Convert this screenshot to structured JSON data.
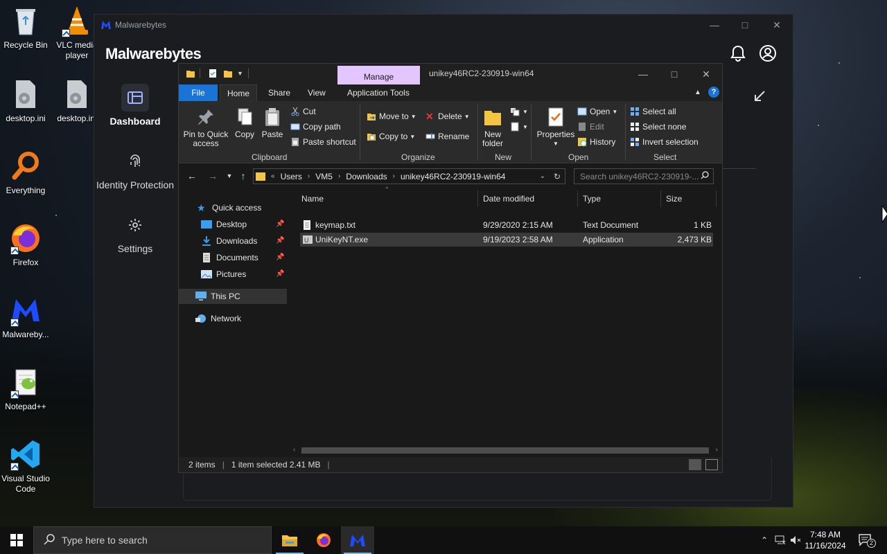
{
  "desktop": {
    "icons": [
      {
        "label": "Recycle Bin"
      },
      {
        "label": "VLC media player"
      },
      {
        "label": "desktop.ini"
      },
      {
        "label": "desktop.ini"
      },
      {
        "label": "Everything"
      },
      {
        "label": "Firefox"
      },
      {
        "label": "Malwareby..."
      },
      {
        "label": "Notepad++"
      },
      {
        "label": "Visual Studio Code"
      }
    ]
  },
  "malwarebytes": {
    "window_title": "Malwarebytes",
    "brand": "Malwarebytes",
    "nav": [
      {
        "label": "Dashboard",
        "icon": "dashboard-icon"
      },
      {
        "label": "Identity Protection",
        "icon": "fingerprint-icon"
      },
      {
        "label": "Settings",
        "icon": "gear-icon"
      }
    ]
  },
  "explorer": {
    "manage_tab": "Manage",
    "title": "unikey46RC2-230919-win64",
    "tabs": [
      "File",
      "Home",
      "Share",
      "View",
      "Application Tools"
    ],
    "ribbon": {
      "clipboard": {
        "group": "Clipboard",
        "pin": "Pin to Quick access",
        "copy": "Copy",
        "paste": "Paste",
        "cut": "Cut",
        "copy_path": "Copy path",
        "paste_shortcut": "Paste shortcut"
      },
      "organize": {
        "group": "Organize",
        "move_to": "Move to",
        "copy_to": "Copy to",
        "delete": "Delete",
        "rename": "Rename"
      },
      "new": {
        "group": "New",
        "new_folder": "New folder"
      },
      "open": {
        "group": "Open",
        "properties": "Properties",
        "open": "Open",
        "edit": "Edit",
        "history": "History"
      },
      "select": {
        "group": "Select",
        "select_all": "Select all",
        "select_none": "Select none",
        "invert": "Invert selection"
      }
    },
    "address": {
      "crumbs": [
        "Users",
        "VM5",
        "Downloads",
        "unikey46RC2-230919-win64"
      ],
      "search_placeholder": "Search unikey46RC2-230919-..."
    },
    "nav": {
      "quick_access": "Quick access",
      "items": [
        {
          "label": "Desktop"
        },
        {
          "label": "Downloads"
        },
        {
          "label": "Documents"
        },
        {
          "label": "Pictures"
        }
      ],
      "this_pc": "This PC",
      "network": "Network"
    },
    "columns": {
      "name": "Name",
      "date": "Date modified",
      "type": "Type",
      "size": "Size"
    },
    "files": [
      {
        "name": "keymap.txt",
        "date": "9/29/2020 2:15 AM",
        "type": "Text Document",
        "size": "1 KB"
      },
      {
        "name": "UniKeyNT.exe",
        "date": "9/19/2023 2:58 AM",
        "type": "Application",
        "size": "2,473 KB"
      }
    ],
    "status": {
      "items": "2 items",
      "selected": "1 item selected  2.41 MB"
    }
  },
  "taskbar": {
    "search_placeholder": "Type here to search",
    "time": "7:48 AM",
    "date": "11/16/2024",
    "notifications": "2"
  }
}
